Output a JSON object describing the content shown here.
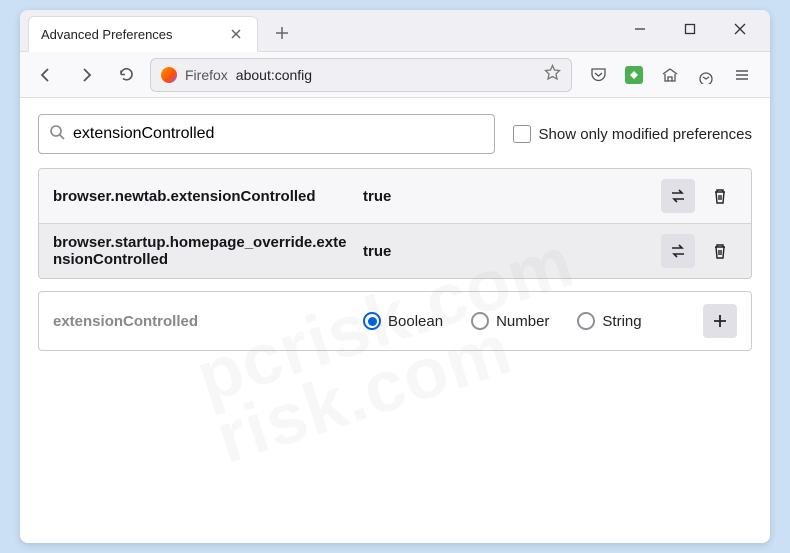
{
  "tab": {
    "title": "Advanced Preferences"
  },
  "url": {
    "label": "Firefox",
    "value": "about:config"
  },
  "search": {
    "value": "extensionControlled"
  },
  "options": {
    "show_modified_label": "Show only modified preferences"
  },
  "prefs": [
    {
      "name": "browser.newtab.extensionControlled",
      "value": "true"
    },
    {
      "name": "browser.startup.homepage_override.extensionControlled",
      "value": "true"
    }
  ],
  "add": {
    "name": "extensionControlled",
    "types": {
      "boolean": "Boolean",
      "number": "Number",
      "string": "String"
    }
  },
  "watermark": {
    "line1": "pcrisk.com",
    "line2": "risk.com"
  }
}
